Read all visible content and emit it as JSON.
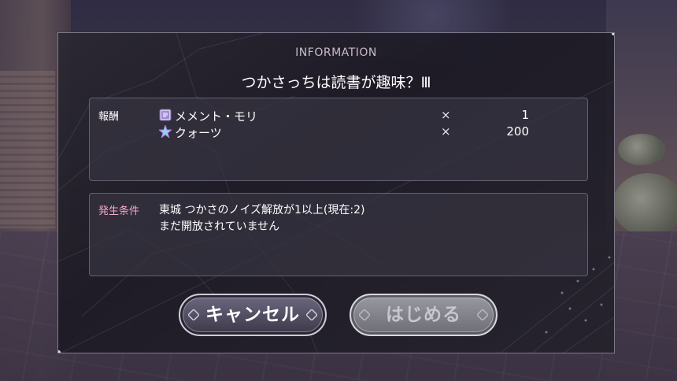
{
  "dialog": {
    "header": "INFORMATION",
    "title": "つかさっちは読書が趣味？Ⅲ"
  },
  "rewards": {
    "label": "報酬",
    "items": [
      {
        "icon": "memento-item-icon",
        "name": "メメント・モリ",
        "x": "×",
        "qty": "1"
      },
      {
        "icon": "quartz-star-icon",
        "name": "クォーツ",
        "x": "×",
        "qty": "200"
      }
    ]
  },
  "conditions": {
    "label": "発生条件",
    "lines": [
      "東城 つかさのノイズ解放が1以上(現在:2)",
      "まだ開放されていません"
    ]
  },
  "buttons": {
    "cancel": "キャンセル",
    "start": "はじめる"
  },
  "colors": {
    "condition_label": "#f4a8c8",
    "panel_border": "#a09bb4",
    "disabled_button": "#8a8a92"
  }
}
